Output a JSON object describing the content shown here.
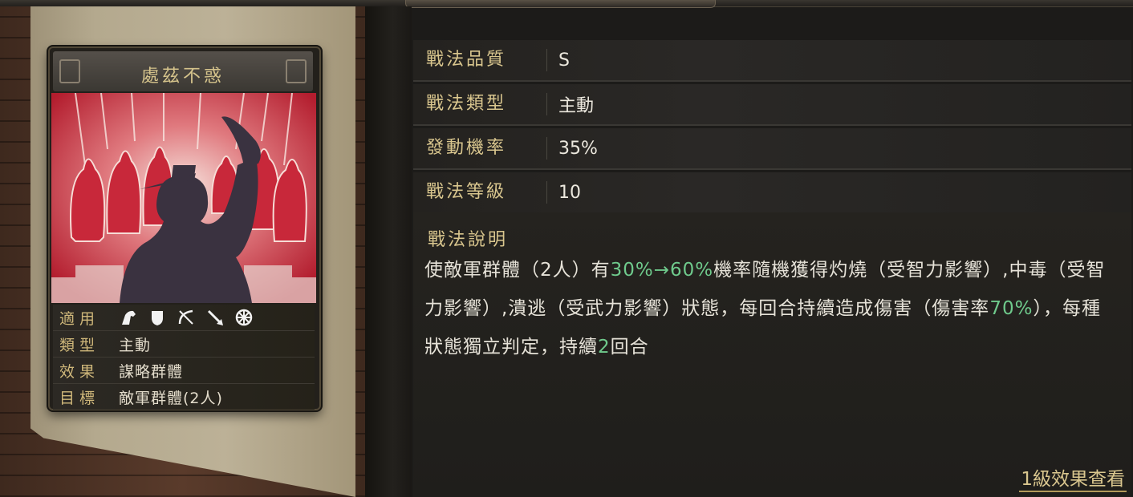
{
  "card": {
    "title": "處茲不惑",
    "rows": [
      {
        "key": "適用",
        "icons": [
          "cavalry-icon",
          "shield-icon",
          "bow-icon",
          "spear-icon",
          "chariot-wheel-icon"
        ]
      },
      {
        "key": "類型",
        "value": "主動"
      },
      {
        "key": "效果",
        "value": "謀略群體"
      },
      {
        "key": "目標",
        "value": "敵軍群體(2人)"
      }
    ]
  },
  "info": {
    "quality": {
      "label": "戰法品質",
      "value": "S"
    },
    "type": {
      "label": "戰法類型",
      "value": "主動"
    },
    "rate": {
      "label": "發動機率",
      "value": "35%"
    },
    "level": {
      "label": "戰法等級",
      "value": "10"
    }
  },
  "description": {
    "title": "戰法說明",
    "seg1": "使敵軍群體（2人）有",
    "hl1": "30%→60%",
    "seg2": "機率隨機獲得灼燒（受智力影響）,中毒（受智力影響）,潰逃（受武力影響）狀態，每回合持續造成傷害（傷害率",
    "hl2": "70%",
    "seg3": "），每種狀態獨立判定，持續",
    "hl3": "2",
    "seg4": "回合"
  },
  "level_effect_link": "1級效果查看",
  "colors": {
    "accent_gold": "#d9c68e",
    "highlight_green": "#6fca8c",
    "art_red": "#c8283a"
  }
}
